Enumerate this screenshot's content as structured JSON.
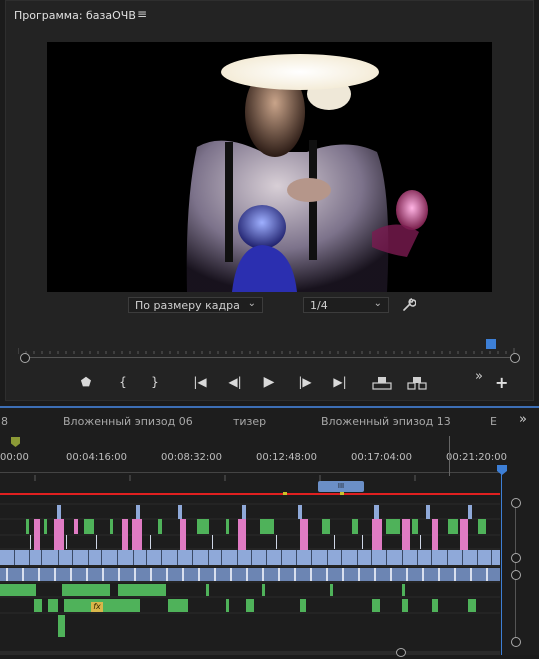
{
  "program": {
    "title": "Программа: базаОЧВ",
    "menu_icon": "≡",
    "fit_label": "По размеру кадра",
    "resolution_label": "1/4"
  },
  "controls": {
    "marker": "⬟",
    "in_point": "{",
    "out_point": "}",
    "go_in": "|◀",
    "step_back": "◀|",
    "play": "▶",
    "step_fwd": "|▶",
    "go_out": "▶|",
    "lift": "lift-icon",
    "extract": "extract-icon",
    "more": "»",
    "add": "+"
  },
  "timeline": {
    "sequences": [
      "8",
      "Вложенный эпизод 06",
      "тизер",
      "Вложенный эпизод 13",
      "E"
    ],
    "more": "»",
    "timecodes": [
      "00:00",
      "00:04:16:00",
      "00:08:32:00",
      "00:12:48:00",
      "00:17:04:00",
      "00:21:20:00"
    ],
    "work_area_handle": "III",
    "fx_badge": "fx"
  },
  "colors": {
    "accent_blue": "#3d7fd6",
    "clip_blue": "#8fa9d9",
    "clip_green": "#4fb25a",
    "clip_pink": "#e07bc4",
    "render_red": "#e02020",
    "marker_olive": "#8c9a36"
  }
}
